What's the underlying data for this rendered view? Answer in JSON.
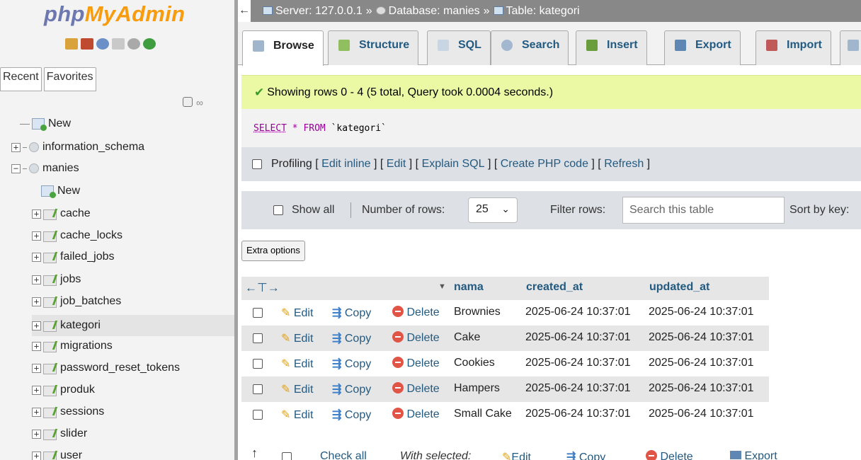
{
  "logo": {
    "php": "php",
    "myadmin": "MyAdmin"
  },
  "nav": {
    "recent_tab": "Recent",
    "favorites_tab": "Favorites",
    "tree": {
      "new_top": "New",
      "db_information_schema": "information_schema",
      "db_manies": "manies",
      "manies_new": "New",
      "tables": [
        "cache",
        "cache_locks",
        "failed_jobs",
        "jobs",
        "job_batches",
        "kategori",
        "migrations",
        "password_reset_tokens",
        "produk",
        "sessions",
        "slider",
        "user"
      ]
    }
  },
  "breadcrumb": {
    "server": "Server: 127.0.0.1",
    "database": "Database: manies",
    "table": "Table: kategori",
    "sep": "»"
  },
  "tabs": [
    "Browse",
    "Structure",
    "SQL",
    "Search",
    "Insert",
    "Export",
    "Import"
  ],
  "success_message": "Showing rows 0 - 4 (5 total, Query took 0.0004 seconds.)",
  "sql": {
    "select": "SELECT",
    "star": "*",
    "from": "FROM",
    "table": "`kategori`"
  },
  "profiling": {
    "label": "Profiling",
    "links": [
      "Edit inline",
      "Edit",
      "Explain SQL",
      "Create PHP code",
      "Refresh"
    ]
  },
  "filter": {
    "show_all": "Show all",
    "number_of_rows": "Number of rows:",
    "rows_value": "25",
    "filter_rows": "Filter rows:",
    "search_placeholder": "Search this table",
    "sort_by_key": "Sort by key:"
  },
  "extra_options": "Extra options",
  "table": {
    "headers": [
      "nama",
      "created_at",
      "updated_at"
    ],
    "actions": {
      "edit": "Edit",
      "copy": "Copy",
      "delete": "Delete"
    },
    "rows": [
      {
        "nama": "Brownies",
        "created_at": "2025-06-24 10:37:01",
        "updated_at": "2025-06-24 10:37:01"
      },
      {
        "nama": "Cake",
        "created_at": "2025-06-24 10:37:01",
        "updated_at": "2025-06-24 10:37:01"
      },
      {
        "nama": "Cookies",
        "created_at": "2025-06-24 10:37:01",
        "updated_at": "2025-06-24 10:37:01"
      },
      {
        "nama": "Hampers",
        "created_at": "2025-06-24 10:37:01",
        "updated_at": "2025-06-24 10:37:01"
      },
      {
        "nama": "Small Cake",
        "created_at": "2025-06-24 10:37:01",
        "updated_at": "2025-06-24 10:37:01"
      }
    ]
  },
  "bottom": {
    "check_all": "Check all",
    "with_selected": "With selected:",
    "edit": "Edit",
    "copy": "Copy",
    "delete": "Delete",
    "export": "Export"
  }
}
